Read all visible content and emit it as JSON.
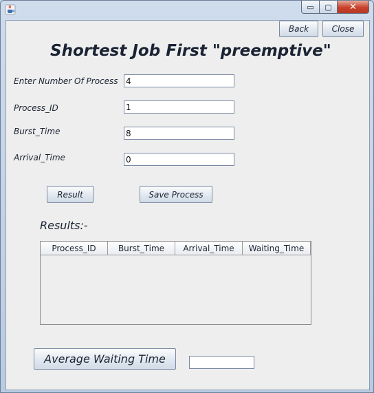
{
  "window": {
    "controls": {
      "minimize": "▭",
      "maximize": "▢",
      "close": "✕"
    }
  },
  "toolbar": {
    "back_label": "Back",
    "close_label": "Close"
  },
  "header": {
    "title": "Shortest Job First \"preemptive\""
  },
  "form": {
    "num_process": {
      "label": "Enter Number Of Process",
      "value": "4"
    },
    "process_id": {
      "label": "Process_ID",
      "value": "1"
    },
    "burst_time": {
      "label": "Burst_Time",
      "value": "8"
    },
    "arrival_time": {
      "label": "Arrival_Time",
      "value": "0"
    }
  },
  "actions": {
    "result_label": "Result",
    "save_label": "Save Process"
  },
  "results": {
    "label": "Results:-",
    "columns": [
      "Process_ID",
      "Burst_Time",
      "Arrival_Time",
      "Waiting_Time"
    ],
    "rows": []
  },
  "average": {
    "button_label": "Average Waiting Time",
    "value": ""
  },
  "icons": {
    "app": "java-cup-icon"
  }
}
